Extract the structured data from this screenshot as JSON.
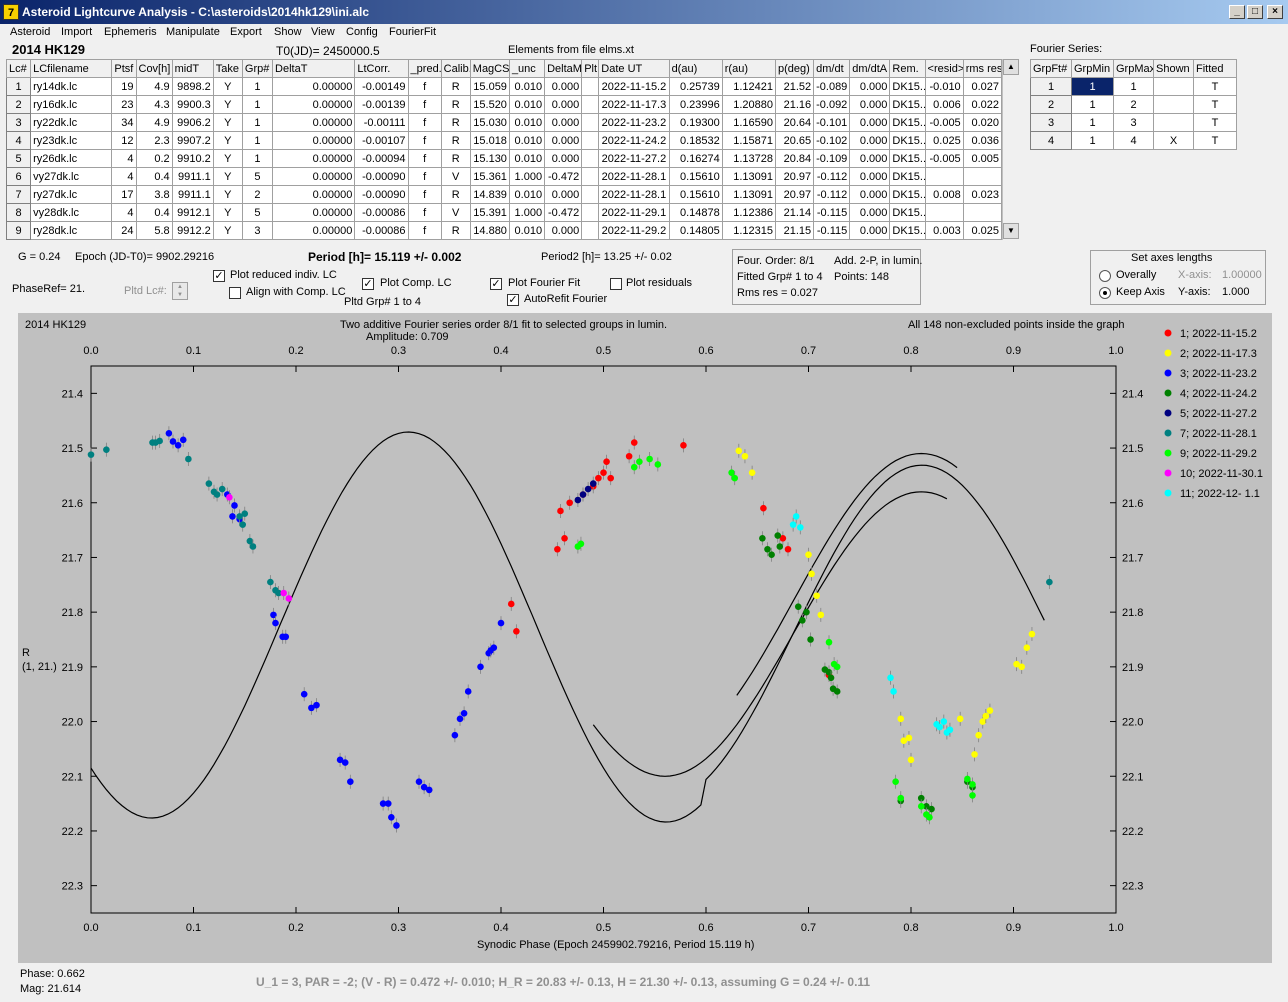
{
  "window": {
    "title": "Asteroid Lightcurve Analysis - C:\\asteroids\\2014hk129\\ini.alc",
    "icon_glyph": "7"
  },
  "menu": [
    "Asteroid",
    "Import",
    "Ephemeris",
    "Manipulate",
    "Export",
    "Show",
    "View",
    "Config",
    "FourierFit"
  ],
  "header": {
    "object_name": "2014 HK129",
    "t0": "T0(JD)= 2450000.5",
    "elements": "Elements from file elms.xt",
    "fourier_series_label": "Fourier Series:"
  },
  "lc_table": {
    "columns": [
      "Lc#",
      "LCfilename",
      "Ptsf",
      "Cov[h]",
      "midT",
      "Take",
      "Grp#",
      "DeltaT",
      "LtCorr.",
      "_pred.",
      "Calib.",
      "MagCS",
      "_unc",
      "DeltaM",
      "Plt",
      "Date UT",
      "d(au)",
      "r(au)",
      "p(deg)",
      "dm/dt",
      "dm/dtA",
      "Rem.",
      "<resid>",
      "rms res"
    ],
    "rows": [
      [
        "1",
        "ry14dk.lc",
        "19",
        "4.9",
        "9898.2",
        "Y",
        "1",
        "0.00000",
        "-0.00149",
        "f",
        "R",
        "15.059",
        "0.010",
        "0.000",
        "",
        "2022-11-15.2",
        "0.25739",
        "1.12421",
        "21.52",
        "-0.089",
        "0.000",
        "DK15...",
        "-0.010",
        "0.027"
      ],
      [
        "2",
        "ry16dk.lc",
        "23",
        "4.3",
        "9900.3",
        "Y",
        "1",
        "0.00000",
        "-0.00139",
        "f",
        "R",
        "15.520",
        "0.010",
        "0.000",
        "",
        "2022-11-17.3",
        "0.23996",
        "1.20880",
        "21.16",
        "-0.092",
        "0.000",
        "DK15...",
        "0.006",
        "0.022"
      ],
      [
        "3",
        "ry22dk.lc",
        "34",
        "4.9",
        "9906.2",
        "Y",
        "1",
        "0.00000",
        "-0.00111",
        "f",
        "R",
        "15.030",
        "0.010",
        "0.000",
        "",
        "2022-11-23.2",
        "0.19300",
        "1.16590",
        "20.64",
        "-0.101",
        "0.000",
        "DK15...",
        "-0.005",
        "0.020"
      ],
      [
        "4",
        "ry23dk.lc",
        "12",
        "2.3",
        "9907.2",
        "Y",
        "1",
        "0.00000",
        "-0.00107",
        "f",
        "R",
        "15.018",
        "0.010",
        "0.000",
        "",
        "2022-11-24.2",
        "0.18532",
        "1.15871",
        "20.65",
        "-0.102",
        "0.000",
        "DK15...",
        "0.025",
        "0.036"
      ],
      [
        "5",
        "ry26dk.lc",
        "4",
        "0.2",
        "9910.2",
        "Y",
        "1",
        "0.00000",
        "-0.00094",
        "f",
        "R",
        "15.130",
        "0.010",
        "0.000",
        "",
        "2022-11-27.2",
        "0.16274",
        "1.13728",
        "20.84",
        "-0.109",
        "0.000",
        "DK15...",
        "-0.005",
        "0.005"
      ],
      [
        "6",
        "vy27dk.lc",
        "4",
        "0.4",
        "9911.1",
        "Y",
        "5",
        "0.00000",
        "-0.00090",
        "f",
        "V",
        "15.361",
        "1.000",
        "-0.472",
        "",
        "2022-11-28.1",
        "0.15610",
        "1.13091",
        "20.97",
        "-0.112",
        "0.000",
        "DK15...",
        "",
        ""
      ],
      [
        "7",
        "ry27dk.lc",
        "17",
        "3.8",
        "9911.1",
        "Y",
        "2",
        "0.00000",
        "-0.00090",
        "f",
        "R",
        "14.839",
        "0.010",
        "0.000",
        "",
        "2022-11-28.1",
        "0.15610",
        "1.13091",
        "20.97",
        "-0.112",
        "0.000",
        "DK15...",
        "0.008",
        "0.023"
      ],
      [
        "8",
        "vy28dk.lc",
        "4",
        "0.4",
        "9912.1",
        "Y",
        "5",
        "0.00000",
        "-0.00086",
        "f",
        "V",
        "15.391",
        "1.000",
        "-0.472",
        "",
        "2022-11-29.1",
        "0.14878",
        "1.12386",
        "21.14",
        "-0.115",
        "0.000",
        "DK15...",
        "",
        ""
      ],
      [
        "9",
        "ry28dk.lc",
        "24",
        "5.8",
        "9912.2",
        "Y",
        "3",
        "0.00000",
        "-0.00086",
        "f",
        "R",
        "14.880",
        "0.010",
        "0.000",
        "",
        "2022-11-29.2",
        "0.14805",
        "1.12315",
        "21.15",
        "-0.115",
        "0.000",
        "DK15...",
        "0.003",
        "0.025"
      ]
    ]
  },
  "fourier_table": {
    "columns": [
      "GrpFt#",
      "GrpMin",
      "GrpMax",
      "Shown",
      "Fitted"
    ],
    "rows": [
      [
        "1",
        "1",
        "1",
        "",
        "T"
      ],
      [
        "2",
        "1",
        "2",
        "",
        "T"
      ],
      [
        "3",
        "1",
        "3",
        "",
        "T"
      ],
      [
        "4",
        "1",
        "4",
        "X",
        "T"
      ]
    ]
  },
  "controls": {
    "g_value": "G = 0.24",
    "epoch": "Epoch (JD-T0)= 9902.29216",
    "period": "Period [h]= 15.119 +/- 0.002",
    "period2": "Period2 [h]= 13.25 +/- 0.02",
    "phaseref": "PhaseRef= 21.",
    "pltd_lc": "Pltd Lc#:",
    "plot_reduced": "Plot reduced indiv. LC",
    "align_comp": "Align with Comp. LC",
    "plot_comp": "Plot Comp. LC",
    "pltd_grp": "Pltd Grp#  1   to   4",
    "plot_fourier": "Plot Fourier Fit",
    "autorefit": "AutoRefit Fourier",
    "plot_residuals": "Plot residuals"
  },
  "fit_info": {
    "order": "Four. Order:  8/1",
    "add": "Add. 2-P, in lumin.",
    "fitted": "Fitted Grp# 1 to 4",
    "points": "Points: 148",
    "rms": "Rms res      = 0.027"
  },
  "axes_panel": {
    "title": "Set axes lengths",
    "overally": "Overally",
    "keep_axis": "Keep Axis",
    "x_axis_label": "X-axis:",
    "x_axis_value": "1.00000",
    "y_axis_label": "Y-axis:",
    "y_axis_value": "1.000"
  },
  "graph": {
    "object": "2014 HK129",
    "title": "Two additive Fourier series order 8/1 fit to selected groups in lumin.",
    "amplitude": "Amplitude: 0.709",
    "note": "All 148 non-excluded points inside the graph",
    "xlabel": "Synodic Phase (Epoch 2459902.79216, Period 15.119 h)",
    "ylabel_1": "R",
    "ylabel_2": "(1, 21.)"
  },
  "chart_data": {
    "type": "scatter",
    "x_ticks": [
      "0.0",
      "0.1",
      "0.2",
      "0.3",
      "0.4",
      "0.5",
      "0.6",
      "0.7",
      "0.8",
      "0.9",
      "1.0"
    ],
    "y_ticks": [
      "21.4",
      "21.5",
      "21.6",
      "21.7",
      "21.8",
      "21.9",
      "22.0",
      "22.1",
      "22.2",
      "22.3"
    ],
    "xlim": [
      0,
      1
    ],
    "ylim": [
      22.3,
      21.4
    ],
    "series": [
      {
        "name": "1; 2022-11-15.2",
        "color": "#ff0000",
        "points": [
          [
            0.41,
            21.785
          ],
          [
            0.415,
            21.835
          ],
          [
            0.455,
            21.685
          ],
          [
            0.458,
            21.615
          ],
          [
            0.462,
            21.665
          ],
          [
            0.467,
            21.6
          ],
          [
            0.48,
            21.585
          ],
          [
            0.49,
            21.57
          ],
          [
            0.495,
            21.555
          ],
          [
            0.5,
            21.545
          ],
          [
            0.503,
            21.525
          ],
          [
            0.507,
            21.555
          ],
          [
            0.525,
            21.515
          ],
          [
            0.53,
            21.49
          ],
          [
            0.578,
            21.495
          ],
          [
            0.656,
            21.61
          ],
          [
            0.675,
            21.665
          ],
          [
            0.68,
            21.685
          ],
          [
            0.72,
            21.915
          ]
        ]
      },
      {
        "name": "2; 2022-11-17.3",
        "color": "#ffff00",
        "points": [
          [
            0.632,
            21.505
          ],
          [
            0.638,
            21.515
          ],
          [
            0.645,
            21.545
          ],
          [
            0.7,
            21.695
          ],
          [
            0.703,
            21.73
          ],
          [
            0.708,
            21.77
          ],
          [
            0.712,
            21.805
          ],
          [
            0.79,
            21.995
          ],
          [
            0.793,
            22.035
          ],
          [
            0.798,
            22.03
          ],
          [
            0.8,
            22.07
          ],
          [
            0.848,
            21.995
          ],
          [
            0.862,
            22.06
          ],
          [
            0.866,
            22.025
          ],
          [
            0.87,
            22.0
          ],
          [
            0.873,
            21.99
          ],
          [
            0.877,
            21.98
          ],
          [
            0.903,
            21.895
          ],
          [
            0.908,
            21.9
          ],
          [
            0.913,
            21.865
          ],
          [
            0.918,
            21.84
          ]
        ]
      },
      {
        "name": "3; 2022-11-23.2",
        "color": "#0000ff",
        "points": [
          [
            0.076,
            21.473
          ],
          [
            0.08,
            21.488
          ],
          [
            0.085,
            21.495
          ],
          [
            0.09,
            21.485
          ],
          [
            0.133,
            21.585
          ],
          [
            0.138,
            21.625
          ],
          [
            0.14,
            21.605
          ],
          [
            0.145,
            21.63
          ],
          [
            0.178,
            21.805
          ],
          [
            0.18,
            21.82
          ],
          [
            0.187,
            21.845
          ],
          [
            0.19,
            21.845
          ],
          [
            0.208,
            21.95
          ],
          [
            0.215,
            21.975
          ],
          [
            0.22,
            21.97
          ],
          [
            0.243,
            22.07
          ],
          [
            0.248,
            22.075
          ],
          [
            0.253,
            22.11
          ],
          [
            0.285,
            22.15
          ],
          [
            0.29,
            22.15
          ],
          [
            0.293,
            22.175
          ],
          [
            0.298,
            22.19
          ],
          [
            0.32,
            22.11
          ],
          [
            0.325,
            22.12
          ],
          [
            0.33,
            22.125
          ],
          [
            0.355,
            22.025
          ],
          [
            0.36,
            21.995
          ],
          [
            0.364,
            21.985
          ],
          [
            0.368,
            21.945
          ],
          [
            0.38,
            21.9
          ],
          [
            0.388,
            21.875
          ],
          [
            0.39,
            21.87
          ],
          [
            0.393,
            21.865
          ],
          [
            0.4,
            21.82
          ]
        ]
      },
      {
        "name": "4; 2022-11-24.2",
        "color": "#008000",
        "points": [
          [
            0.655,
            21.665
          ],
          [
            0.66,
            21.685
          ],
          [
            0.664,
            21.695
          ],
          [
            0.67,
            21.66
          ],
          [
            0.672,
            21.68
          ],
          [
            0.69,
            21.79
          ],
          [
            0.694,
            21.815
          ],
          [
            0.698,
            21.8
          ],
          [
            0.702,
            21.85
          ],
          [
            0.716,
            21.905
          ],
          [
            0.72,
            21.91
          ],
          [
            0.722,
            21.92
          ],
          [
            0.724,
            21.94
          ],
          [
            0.728,
            21.945
          ],
          [
            0.79,
            22.145
          ],
          [
            0.81,
            22.14
          ],
          [
            0.815,
            22.155
          ],
          [
            0.82,
            22.16
          ],
          [
            0.855,
            22.11
          ],
          [
            0.86,
            22.12
          ]
        ]
      },
      {
        "name": "5; 2022-11-27.2",
        "color": "#000080",
        "points": [
          [
            0.475,
            21.595
          ],
          [
            0.48,
            21.585
          ],
          [
            0.485,
            21.575
          ],
          [
            0.49,
            21.565
          ]
        ]
      },
      {
        "name": "7; 2022-11-28.1",
        "color": "#008080",
        "points": [
          [
            0.0,
            21.512
          ],
          [
            0.015,
            21.503
          ],
          [
            0.06,
            21.49
          ],
          [
            0.063,
            21.49
          ],
          [
            0.067,
            21.487
          ],
          [
            0.095,
            21.52
          ],
          [
            0.115,
            21.565
          ],
          [
            0.12,
            21.58
          ],
          [
            0.123,
            21.585
          ],
          [
            0.128,
            21.575
          ],
          [
            0.145,
            21.625
          ],
          [
            0.148,
            21.64
          ],
          [
            0.15,
            21.62
          ],
          [
            0.155,
            21.67
          ],
          [
            0.158,
            21.68
          ],
          [
            0.175,
            21.745
          ],
          [
            0.18,
            21.76
          ],
          [
            0.183,
            21.765
          ],
          [
            0.935,
            21.745
          ]
        ]
      },
      {
        "name": "9; 2022-11-29.2",
        "color": "#00ff00",
        "points": [
          [
            0.475,
            21.68
          ],
          [
            0.478,
            21.675
          ],
          [
            0.53,
            21.535
          ],
          [
            0.535,
            21.525
          ],
          [
            0.545,
            21.52
          ],
          [
            0.553,
            21.53
          ],
          [
            0.625,
            21.545
          ],
          [
            0.628,
            21.555
          ],
          [
            0.72,
            21.855
          ],
          [
            0.725,
            21.895
          ],
          [
            0.728,
            21.9
          ],
          [
            0.785,
            22.11
          ],
          [
            0.79,
            22.14
          ],
          [
            0.81,
            22.155
          ],
          [
            0.815,
            22.17
          ],
          [
            0.818,
            22.175
          ],
          [
            0.855,
            22.105
          ],
          [
            0.86,
            22.115
          ],
          [
            0.86,
            22.135
          ]
        ]
      },
      {
        "name": "10; 2022-11-30.1",
        "color": "#ff00ff",
        "points": [
          [
            0.135,
            21.59
          ],
          [
            0.188,
            21.765
          ],
          [
            0.193,
            21.775
          ]
        ]
      },
      {
        "name": "11; 2022-12- 1.1",
        "color": "#00ffff",
        "points": [
          [
            0.685,
            21.64
          ],
          [
            0.688,
            21.625
          ],
          [
            0.692,
            21.645
          ],
          [
            0.78,
            21.92
          ],
          [
            0.783,
            21.945
          ],
          [
            0.825,
            22.005
          ],
          [
            0.828,
            22.01
          ],
          [
            0.832,
            22.0
          ],
          [
            0.835,
            22.02
          ],
          [
            0.838,
            22.015
          ]
        ]
      }
    ]
  },
  "status": {
    "phase": "Phase:  0.662",
    "mag": "Mag:    21.614",
    "summary": "U_1 = 3, PAR = -2; (V - R) = 0.472 +/- 0.010; H_R = 20.83 +/- 0.13, H = 21.30 +/- 0.13, assuming G = 0.24 +/- 0.11"
  }
}
